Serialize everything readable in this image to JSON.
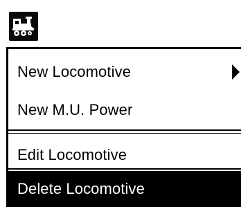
{
  "toolbar": {
    "icon": "locomotive-icon"
  },
  "menu": {
    "items": [
      {
        "label": "New Locomotive",
        "has_submenu": true,
        "selected": false
      },
      {
        "label": "New M.U. Power",
        "has_submenu": false,
        "selected": false
      },
      {
        "label": "Edit Locomotive",
        "has_submenu": false,
        "selected": false
      },
      {
        "label": "Delete Locomotive",
        "has_submenu": false,
        "selected": true
      }
    ],
    "submenu_icon": "chevron-right-icon"
  },
  "colors": {
    "background": "#ffffff",
    "text": "#000000",
    "selected_background": "#000000",
    "selected_text": "#ffffff"
  }
}
